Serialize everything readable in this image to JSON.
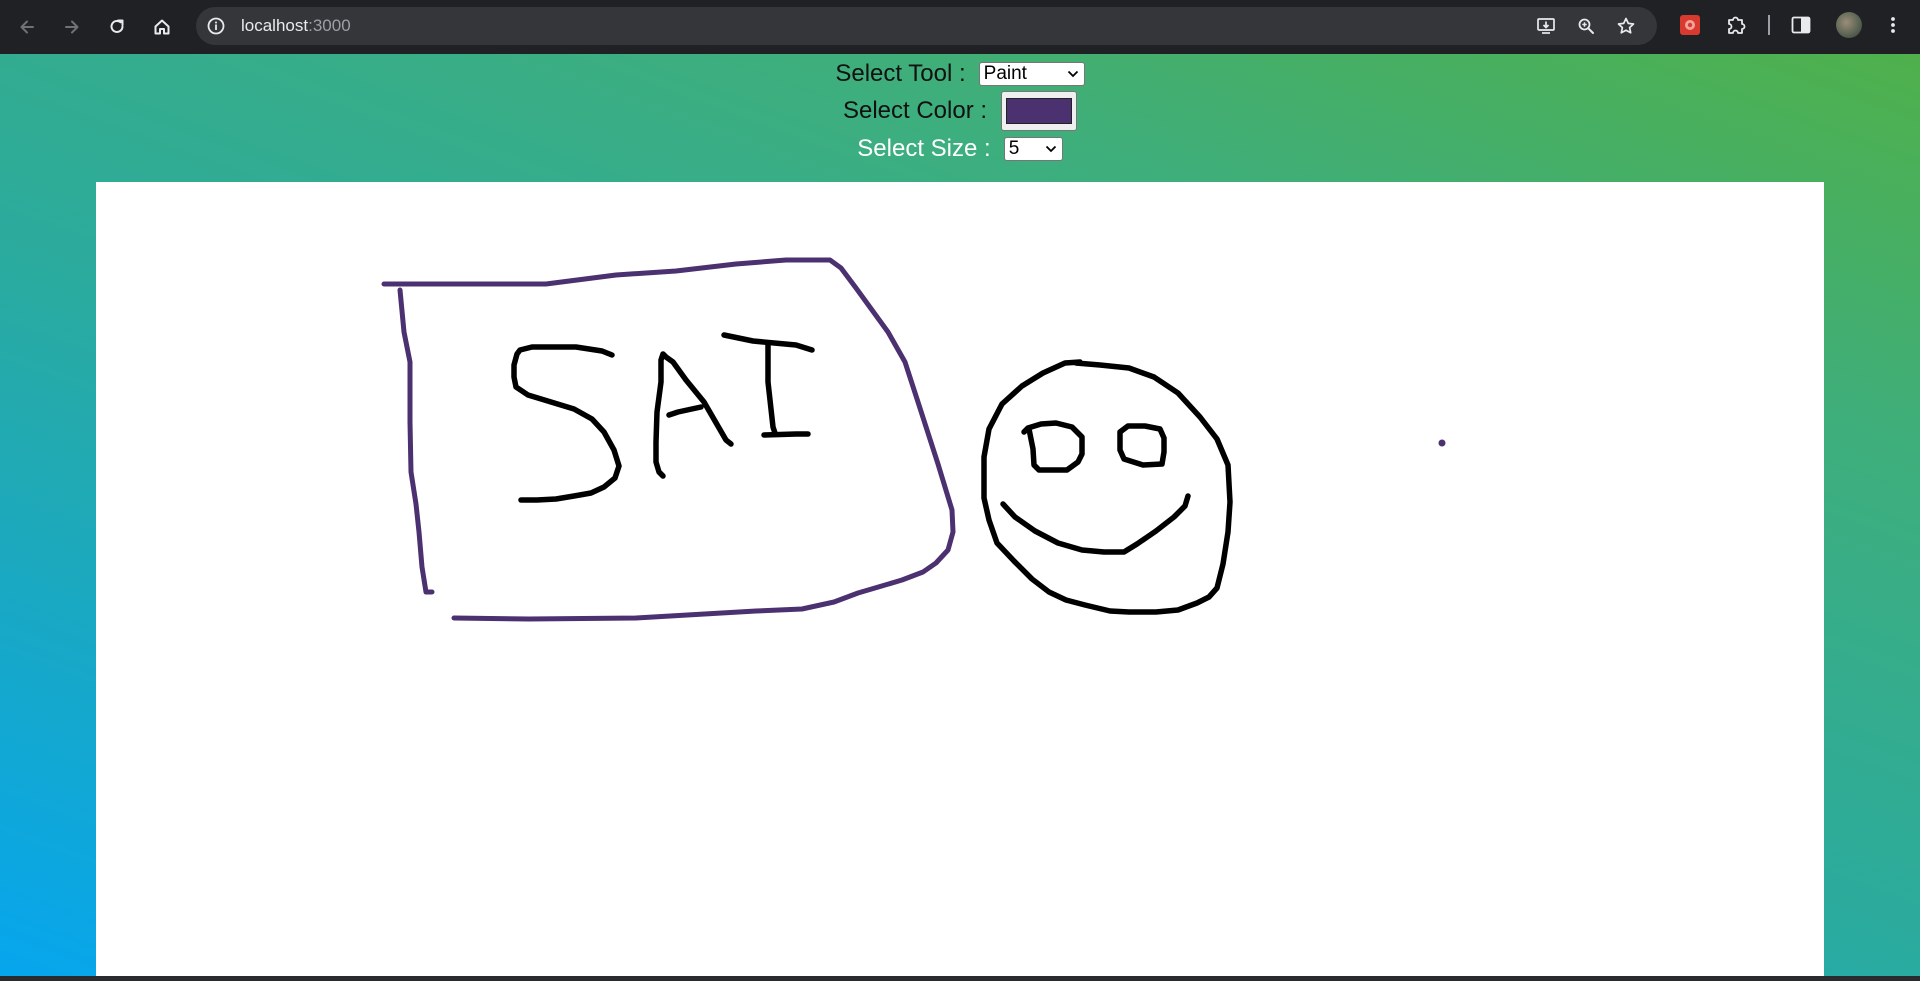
{
  "browser": {
    "url_host": "localhost",
    "url_port": ":3000",
    "icons": {
      "back": "arrow-left-icon",
      "forward": "arrow-right-icon",
      "reload": "reload-icon",
      "home": "home-icon",
      "site_info": "info-icon",
      "install": "install-app-icon",
      "zoom": "zoom-icon",
      "bookmark": "star-icon",
      "extension_red": "extension-icon",
      "extensions": "puzzle-icon",
      "side_panel": "side-panel-icon",
      "menu": "more-vert-icon"
    }
  },
  "controls": {
    "tool_label": "Select Tool :",
    "tool_value": "Paint",
    "color_label": "Select Color :",
    "color_value": "#4b3170",
    "size_label": "Select Size :",
    "size_value": "5"
  },
  "canvas": {
    "background": "#ffffff",
    "stroke_color_purple": "#4b3170",
    "stroke_color_black": "#000000"
  },
  "theme": {
    "gradient_start": "#06a6ee",
    "gradient_mid": "#2bab9e",
    "gradient_end": "#4fb04b"
  }
}
